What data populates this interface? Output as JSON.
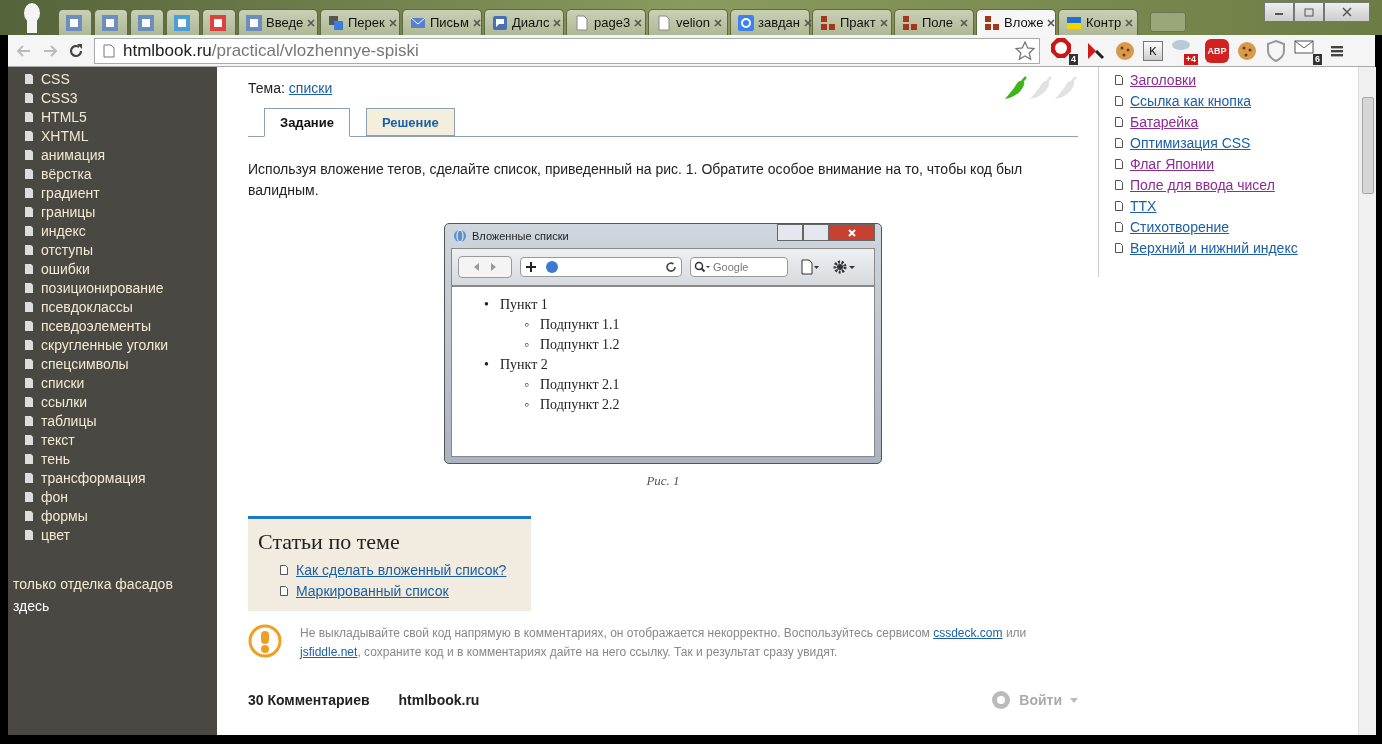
{
  "browser": {
    "tabs": [
      {
        "kind": "h",
        "selected": false
      },
      {
        "kind": "h",
        "selected": false
      },
      {
        "kind": "h",
        "selected": false
      },
      {
        "kind": "dc",
        "selected": false
      },
      {
        "kind": "t",
        "selected": false
      },
      {
        "kind": "h",
        "title": "Введе",
        "selected": false
      },
      {
        "kind": "translate",
        "title": "Перек",
        "selected": false
      },
      {
        "kind": "mail",
        "title": "Письм",
        "selected": false
      },
      {
        "kind": "chat",
        "title": "Диалс",
        "selected": false
      },
      {
        "kind": "doc",
        "title": "page3",
        "selected": false
      },
      {
        "kind": "doc",
        "title": "velion",
        "selected": false
      },
      {
        "kind": "google",
        "title": "завдан",
        "selected": false
      },
      {
        "kind": "blocks",
        "title": "Практ",
        "selected": false
      },
      {
        "kind": "blocks",
        "title": "Поле",
        "selected": false
      },
      {
        "kind": "blocks",
        "title": "Вложе",
        "selected": true
      },
      {
        "kind": "flag",
        "title": "Контр",
        "selected": false
      }
    ],
    "url_host": "htmlbook.ru",
    "url_path": "/practical/vlozhennye-spiski",
    "extensions": [
      {
        "kind": "stop",
        "badge": "4"
      },
      {
        "kind": "antivirus"
      },
      {
        "kind": "cookie"
      },
      {
        "kind": "k",
        "badge": "K"
      },
      {
        "kind": "cloud",
        "badge": "+4"
      },
      {
        "kind": "abp",
        "badge": "ABP"
      },
      {
        "kind": "cookie"
      },
      {
        "kind": "shield"
      },
      {
        "kind": "mail",
        "badge": "6"
      }
    ]
  },
  "sidebar": {
    "items": [
      "CSS",
      "CSS3",
      "HTML5",
      "XHTML",
      "анимация",
      "вёрстка",
      "градиент",
      "границы",
      "индекс",
      "отступы",
      "ошибки",
      "позиционирование",
      "псевдоклассы",
      "псевдоэлементы",
      "скругленные уголки",
      "спецсимволы",
      "списки",
      "ссылки",
      "таблицы",
      "текст",
      "тень",
      "трансформация",
      "фон",
      "формы",
      "цвет"
    ],
    "ad_text": "только отделка фасадов",
    "ad_link": "здесь"
  },
  "task": {
    "topic_label": "Тема:",
    "topic": "списки",
    "stars": 1,
    "tabs": [
      {
        "label": "Задание",
        "selected": true
      },
      {
        "label": "Решение",
        "selected": false
      }
    ],
    "text": "Используя вложение тегов, сделайте список, приведенный на рис. 1. Обратите особое внимание на то, чтобы код был валидным.",
    "figure": {
      "window_title": "Вложенные списки",
      "search_placeholder": "Google",
      "list": [
        {
          "marker": "•",
          "text": "Пункт 1",
          "children": [
            {
              "marker": "◦",
              "text": "Подпункт 1.1"
            },
            {
              "marker": "◦",
              "text": "Подпункт 1.2"
            }
          ]
        },
        {
          "marker": "•",
          "text": "Пункт 2",
          "children": [
            {
              "marker": "◦",
              "text": "Подпункт 2.1"
            },
            {
              "marker": "◦",
              "text": "Подпункт 2.2"
            }
          ]
        }
      ],
      "caption": "Рис. 1"
    }
  },
  "related": {
    "title": "Статьи по теме",
    "links": [
      "Как сделать вложенный список?",
      "Маркированный список"
    ]
  },
  "notice": {
    "before": "Не выкладывайте свой код напрямую в комментариях, он отображается некорректно. Воспользуйтесь сервисом ",
    "link1": "cssdeck.com",
    "middle": "или ",
    "link2": "jsfiddle.net",
    "after": ", сохраните код и в комментариях дайте на него ссылку. Так и результат сразу увидят."
  },
  "comments": {
    "count": "30 Комментариев",
    "site": "htmlbook.ru",
    "login": "Войти"
  },
  "right_links": [
    {
      "text": "Заголовки",
      "visited": true
    },
    {
      "text": "Ссылка как кнопка",
      "visited": false
    },
    {
      "text": "Батарейка",
      "visited": true
    },
    {
      "text": "Оптимизация CSS",
      "visited": false
    },
    {
      "text": "Флаг Японии",
      "visited": true
    },
    {
      "text": "Поле для ввода чисел",
      "visited": true
    },
    {
      "text": "ТТХ",
      "visited": false
    },
    {
      "text": "Стихотворение",
      "visited": false
    },
    {
      "text": "Верхний и нижний индекс",
      "visited": false
    }
  ]
}
